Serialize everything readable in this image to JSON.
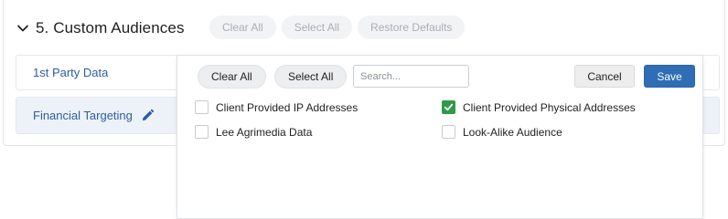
{
  "section": {
    "title": "5. Custom Audiences",
    "chevron_icon": "chevron-down-icon",
    "header_buttons": [
      "Clear All",
      "Select All",
      "Restore Defaults"
    ]
  },
  "rows": [
    {
      "label": "1st Party Data"
    },
    {
      "label": "Financial Targeting",
      "icon": "pencil-icon"
    }
  ],
  "popup": {
    "clear_all": "Clear All",
    "select_all": "Select All",
    "search_placeholder": "Search...",
    "cancel": "Cancel",
    "save": "Save",
    "options": [
      {
        "label": "Client Provided IP Addresses",
        "checked": false
      },
      {
        "label": "Client Provided Physical Addresses",
        "checked": true
      },
      {
        "label": "Lee Agrimedia Data",
        "checked": false
      },
      {
        "label": "Look-Alike Audience",
        "checked": false
      }
    ]
  },
  "colors": {
    "accent_blue": "#2f6db5",
    "link_blue": "#2c5ea1",
    "checked_green": "#2e9b4a"
  }
}
